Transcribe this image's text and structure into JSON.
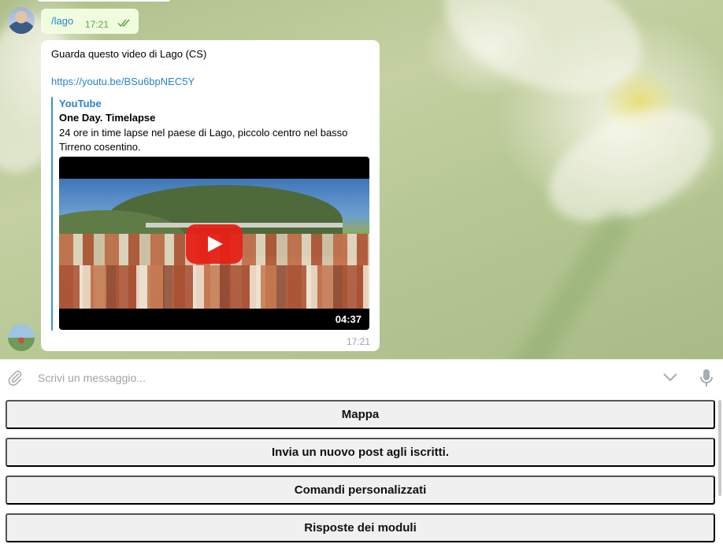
{
  "chat": {
    "outgoing": {
      "command": "/lago",
      "time": "17:21"
    },
    "incoming": {
      "text": "Guarda questo video di Lago (CS)",
      "link": "https://youtu.be/BSu6bpNEC5Y",
      "preview": {
        "site": "YouTube",
        "title": "One Day. Timelapse",
        "description": "24 ore in time lapse nel paese di Lago, piccolo centro nel basso Tirreno cosentino.",
        "duration": "04:37"
      },
      "time": "17:21"
    }
  },
  "composer": {
    "placeholder": "Scrivi un messaggio..."
  },
  "keyboard": {
    "buttons": [
      "Mappa",
      "Invia un nuovo post agli iscritti.",
      "Comandi personalizzati",
      "Risposte dei moduli"
    ]
  },
  "icons": {
    "attach": "paperclip-icon",
    "collapse": "chevron-down-icon",
    "voice": "microphone-icon",
    "read": "double-check-icon",
    "play": "play-icon"
  },
  "colors": {
    "link": "#2a84cc",
    "outgoing_bubble": "#effdde",
    "outgoing_time": "#62a14f",
    "youtube_red": "#e62117"
  }
}
